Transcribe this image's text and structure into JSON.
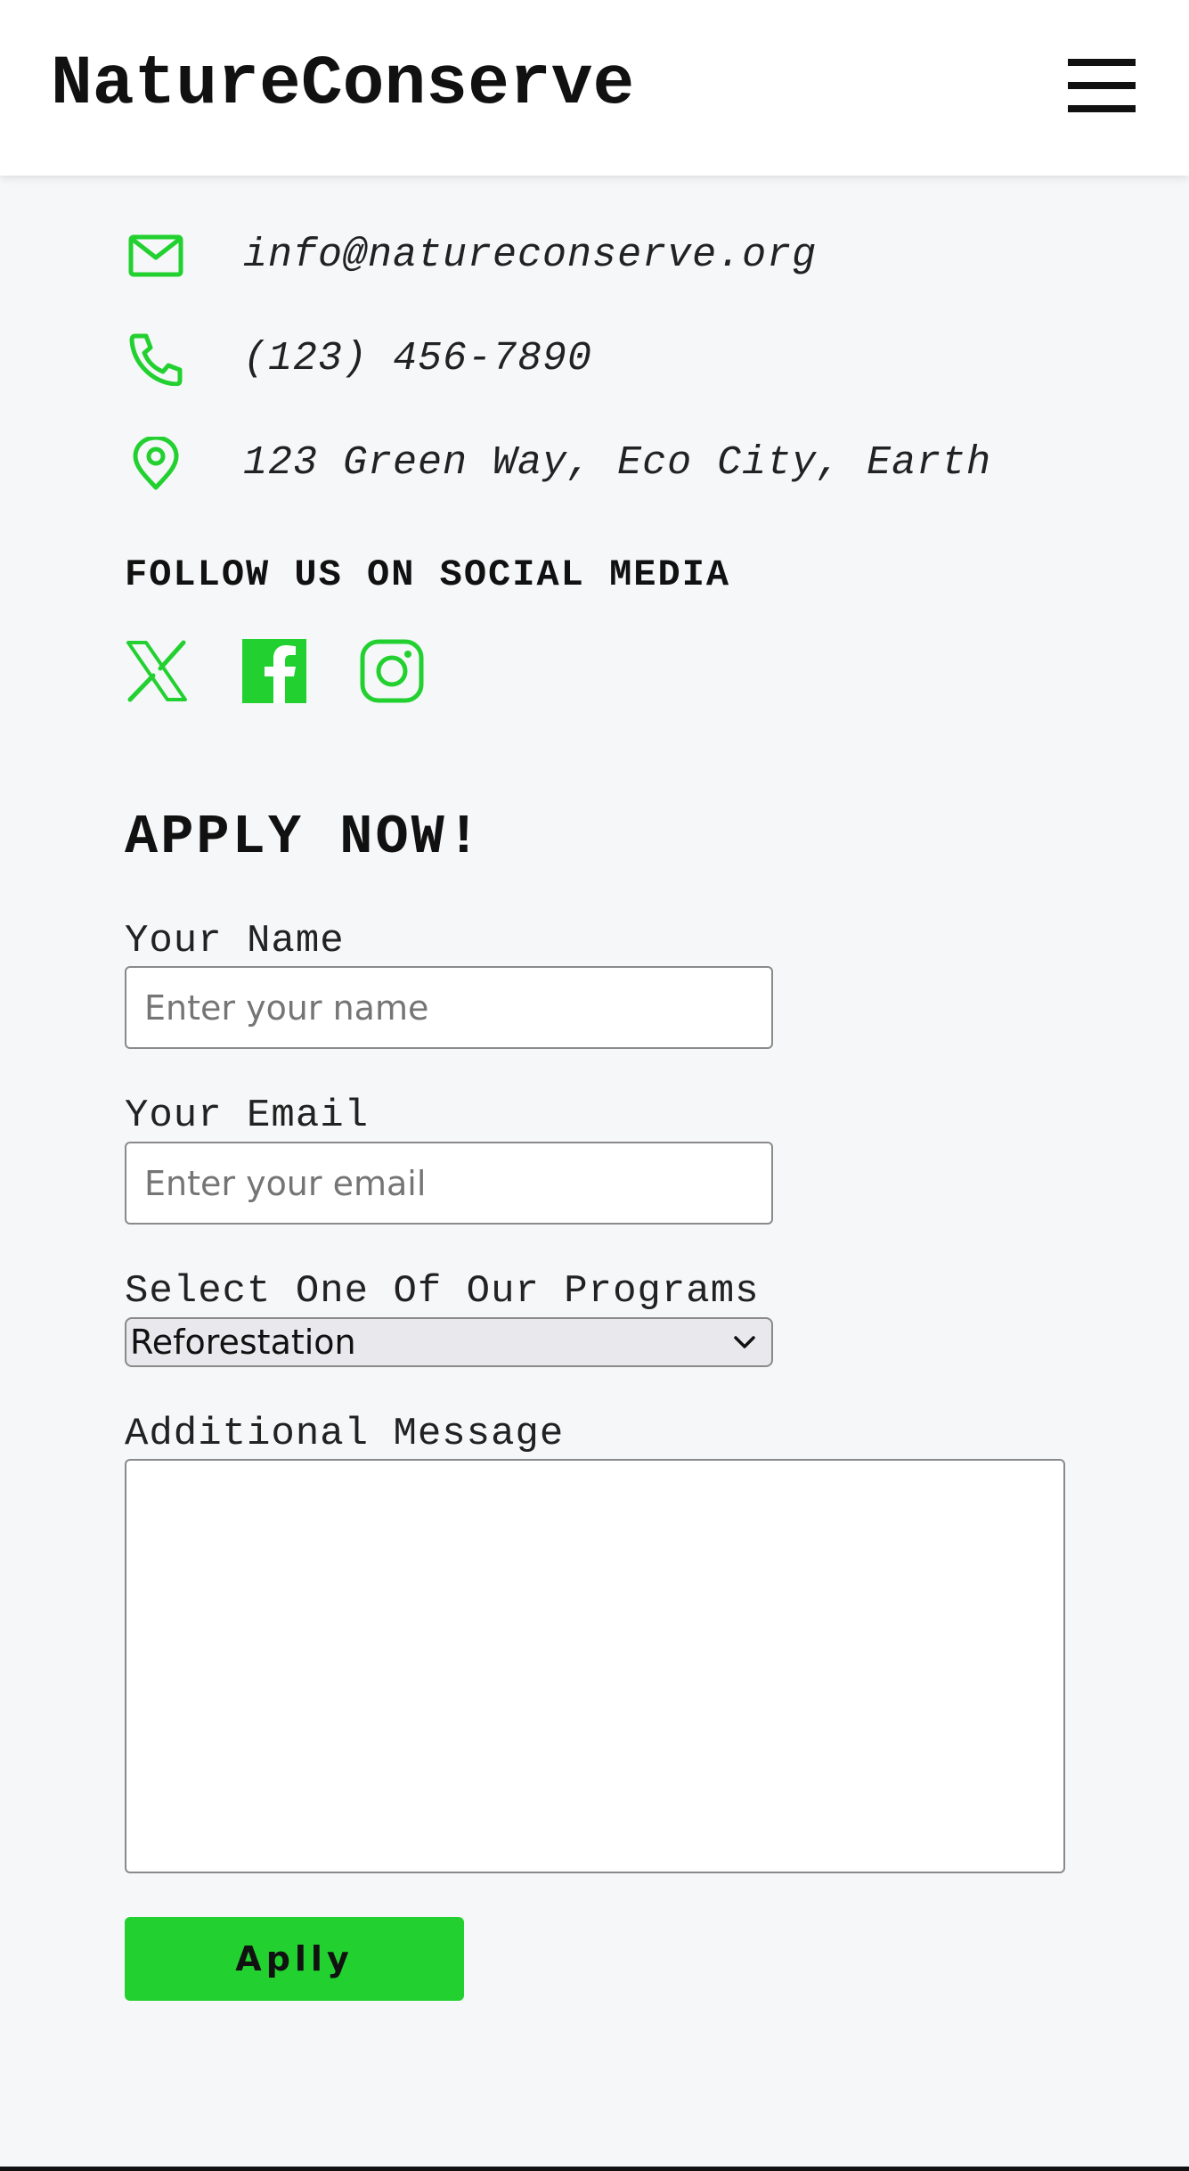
{
  "header": {
    "brand": "NatureConserve",
    "menu_icon": "hamburger-menu-icon"
  },
  "contact": {
    "email": "info@natureconserve.org",
    "phone": "(123) 456-7890",
    "address": "123 Green Way, Eco City, Earth",
    "icons": [
      "envelope-icon",
      "phone-icon",
      "map-pin-icon"
    ]
  },
  "social": {
    "heading": "FOLLOW US ON SOCIAL MEDIA",
    "icons": [
      "x-twitter-icon",
      "facebook-icon",
      "instagram-icon"
    ]
  },
  "form": {
    "heading": "APPLY NOW!",
    "name_label": "Your Name",
    "name_placeholder": "Enter your name",
    "name_value": "",
    "email_label": "Your Email",
    "email_placeholder": "Enter your email",
    "email_value": "",
    "program_label": "Select One Of Our Programs",
    "program_selected": "Reforestation",
    "message_label": "Additional Message",
    "message_value": "",
    "submit_label": "Aplly"
  },
  "colors": {
    "accent": "#22d130",
    "background": "#f6f7f9",
    "header_bg": "#ffffff",
    "text": "#111111"
  }
}
